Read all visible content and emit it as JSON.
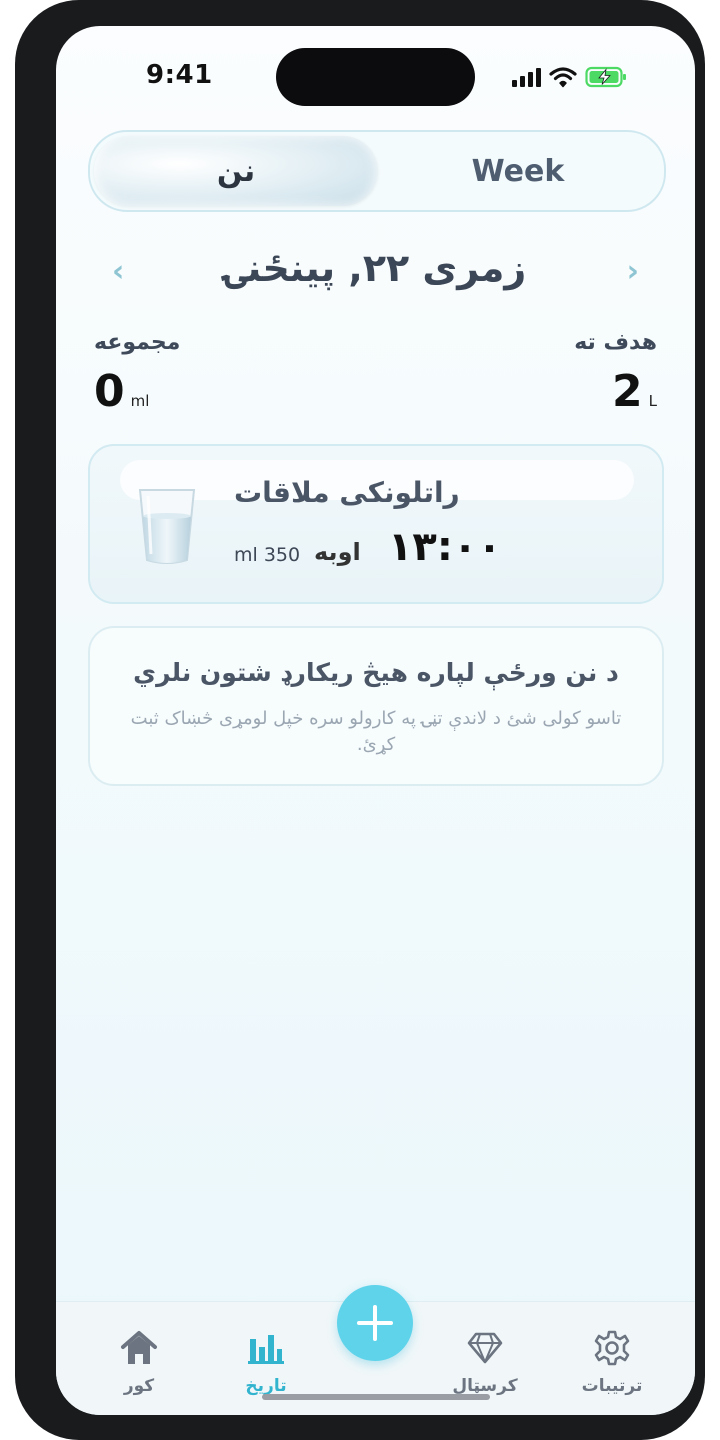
{
  "status_bar": {
    "time": "9:41"
  },
  "segmented": {
    "active_label": "نن",
    "inactive_label": "Week"
  },
  "date_nav": {
    "title": "زمری ۲۲, پينځنۍ"
  },
  "stats": {
    "goal_label": "هدف ته",
    "goal_value": "2",
    "goal_unit": "L",
    "total_label": "مجموعه",
    "total_value": "0",
    "total_unit": "ml"
  },
  "reminder": {
    "title": "راتلونکی ملاقات",
    "time": "۱۳:۰۰",
    "label": "اوبه",
    "amount": "ml 350",
    "icon": "water-glass-icon"
  },
  "empty_state": {
    "title": "د نن ورځې لپاره هيڅ ريکارډ شتون نلري",
    "body": "تاسو کولی شئ د لاندې تڼۍ په کارولو سره خپل لومړی څښاک ثبت کړئ."
  },
  "tabbar": {
    "home_label": "کور",
    "history_label": "تاريخ",
    "crystal_label": "کرسټال",
    "settings_label": "ترتيبات",
    "active_color": "#32b4cf",
    "add_button_color": "#5fd3ea"
  }
}
